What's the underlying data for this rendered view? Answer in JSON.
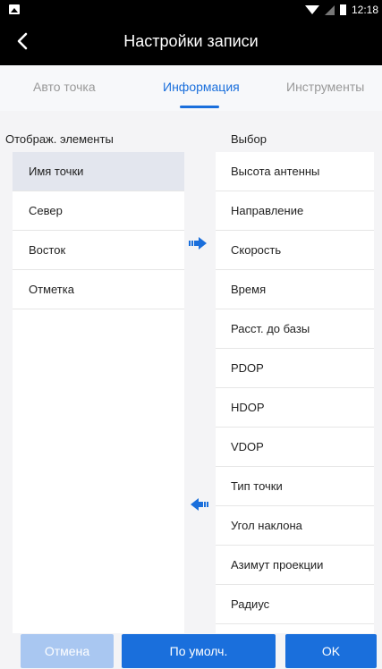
{
  "status": {
    "time": "12:18"
  },
  "header": {
    "title": "Настройки записи"
  },
  "tabs": [
    {
      "label": "Авто точка"
    },
    {
      "label": "Информация"
    },
    {
      "label": "Инструменты"
    }
  ],
  "left_section": {
    "label": "Отображ. элементы",
    "items": [
      "Имя точки",
      "Север",
      "Восток",
      "Отметка"
    ]
  },
  "right_section": {
    "label": "Выбор",
    "items": [
      "Высота антенны",
      "Направление",
      "Скорость",
      "Время",
      "Расст. до базы",
      "PDOP",
      "HDOP",
      "VDOP",
      "Тип точки",
      "Угол наклона",
      "Азимут проекции",
      "Радиус"
    ]
  },
  "buttons": {
    "cancel": "Отмена",
    "default": "По умолч.",
    "ok": "OK"
  },
  "colors": {
    "accent": "#1a6fdc",
    "accent_disabled": "#a9c7f1"
  }
}
